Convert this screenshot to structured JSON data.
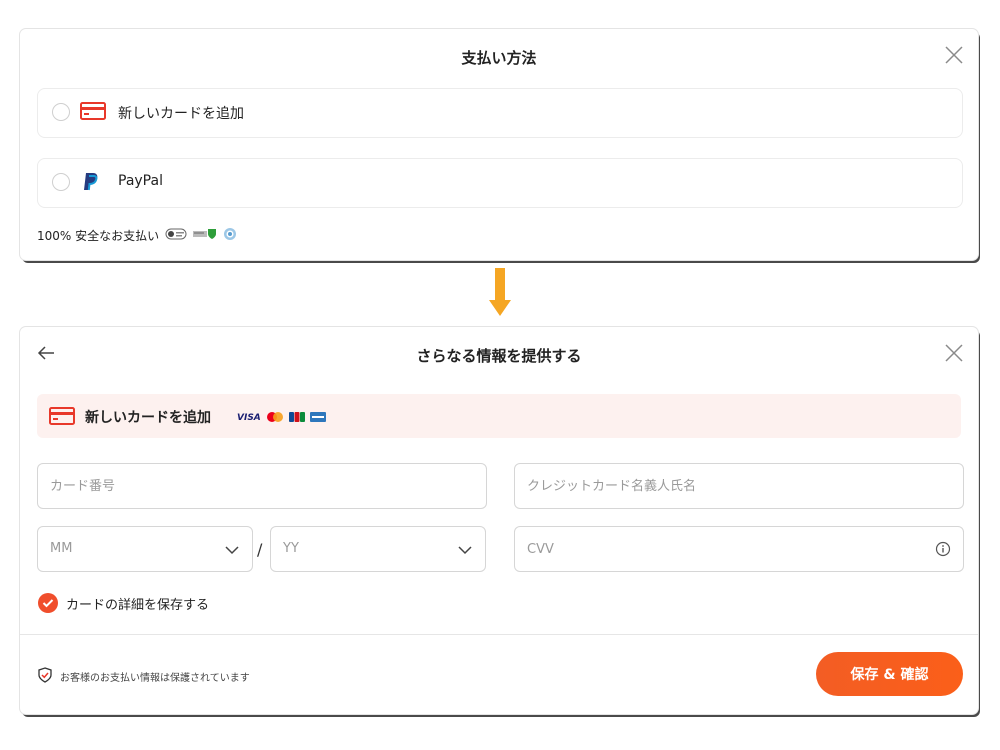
{
  "payment_dialog": {
    "title": "支払い方法",
    "options": [
      {
        "label": "新しいカードを追加",
        "icon": "credit-card-icon"
      },
      {
        "label": "PayPal",
        "icon": "paypal-icon"
      }
    ],
    "secure_text": "100% 安全なお支払い"
  },
  "card_dialog": {
    "title": "さらなる情報を提供する",
    "banner": {
      "label": "新しいカードを追加",
      "brands": [
        "VISA"
      ]
    },
    "fields": {
      "card_number": {
        "placeholder": "カード番号"
      },
      "holder_name": {
        "placeholder": "クレジットカード名義人氏名"
      },
      "month": {
        "placeholder": "MM"
      },
      "separator": "/",
      "year": {
        "placeholder": "YY"
      },
      "cvv": {
        "placeholder": "CVV"
      }
    },
    "save_card": {
      "label": "カードの詳細を保存する",
      "checked": true
    },
    "footer_note": "お客様のお支払い情報は保護されています",
    "submit_label": "保存 & 確認"
  },
  "colors": {
    "accent": "#f04e2c",
    "banner_bg": "#fdf1ef",
    "arrow": "#f5a623"
  }
}
